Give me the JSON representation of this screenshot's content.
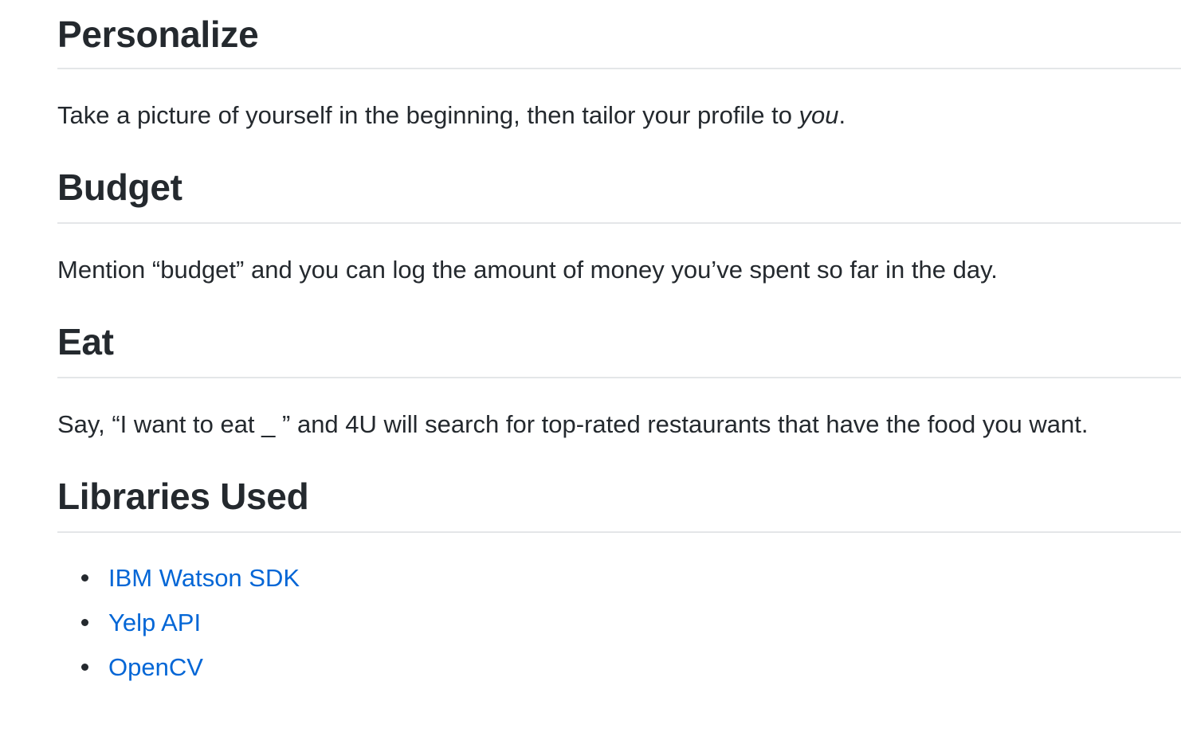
{
  "sections": [
    {
      "title": "Personalize",
      "text_before": "Take a picture of yourself in the beginning, then tailor your profile to ",
      "text_emphasis": "you",
      "text_after": "."
    },
    {
      "title": "Budget",
      "text": "Mention “budget” and you can log the amount of money you’ve spent so far in the day."
    },
    {
      "title": "Eat",
      "text": "Say, “I want to eat _ ” and 4U will search for top-rated restaurants that have the food you want."
    },
    {
      "title": "Libraries Used",
      "links": [
        {
          "label": "IBM Watson SDK"
        },
        {
          "label": "Yelp API"
        },
        {
          "label": "OpenCV"
        }
      ]
    }
  ],
  "colors": {
    "text": "#24292e",
    "link": "#0366d6",
    "rule": "#e4e6e8"
  }
}
